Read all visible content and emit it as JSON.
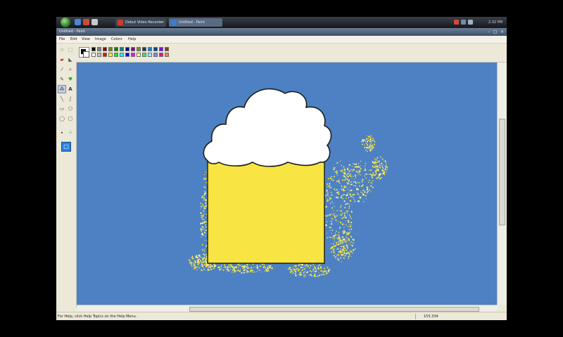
{
  "taskbar": {
    "tasks": [
      {
        "label": "Debut Video Recorder",
        "icon": "record-icon",
        "color": "#d23a2a"
      },
      {
        "label": "Untitled - Paint",
        "icon": "paint-icon",
        "color": "#3a7bd5"
      }
    ],
    "clock": "2:32 PM"
  },
  "window": {
    "title": "Untitled - Paint",
    "controls": [
      "minimize",
      "maximize",
      "close"
    ]
  },
  "menu": [
    "File",
    "Edit",
    "View",
    "Image",
    "Colors",
    "Help"
  ],
  "tools": [
    "free-select-icon",
    "rect-select-icon",
    "eraser-icon",
    "fill-icon",
    "color-picker-icon",
    "magnifier-icon",
    "pencil-icon",
    "brush-icon",
    "airbrush-icon",
    "text-icon",
    "line-icon",
    "curve-icon",
    "rectangle-icon",
    "polygon-icon",
    "ellipse-icon",
    "rounded-rect-icon"
  ],
  "selected_tool": "airbrush-icon",
  "palette": {
    "row1": [
      "#000000",
      "#808080",
      "#800000",
      "#808000",
      "#008000",
      "#008080",
      "#000080",
      "#800080",
      "#808040",
      "#004040",
      "#0080ff",
      "#004080",
      "#8000ff",
      "#804000"
    ],
    "row2": [
      "#ffffff",
      "#c0c0c0",
      "#ff0000",
      "#ffff00",
      "#00ff00",
      "#00ffff",
      "#0000ff",
      "#ff00ff",
      "#ffff80",
      "#00ff80",
      "#80ffff",
      "#8080ff",
      "#ff0080",
      "#ff8040"
    ]
  },
  "canvas": {
    "background": "#4d81c3",
    "foam_color": "#ffffff",
    "beer_color": "#f7e233"
  },
  "status": {
    "help_text": "For Help, click Help Topics on the Help Menu.",
    "coordinates": "155,334"
  }
}
